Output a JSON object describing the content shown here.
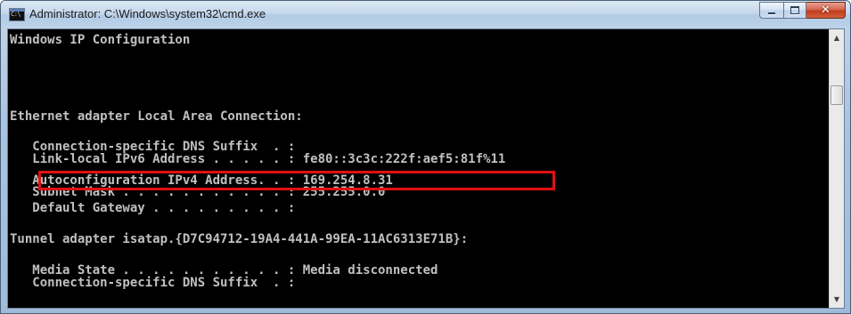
{
  "window": {
    "title": "Administrator: C:\\Windows\\system32\\cmd.exe",
    "icon": "cmd-icon",
    "icon_glyph": "C:\\",
    "minimize_icon": "minimize-icon",
    "maximize_icon": "maximize-icon",
    "close_icon": "close-icon",
    "close_glyph": "✕"
  },
  "console": {
    "lines": [
      "Windows IP Configuration",
      "",
      "",
      "Ethernet adapter Local Area Connection:",
      "",
      "   Connection-specific DNS Suffix  . :",
      "   Link-local IPv6 Address . . . . . : fe80::3c3c:222f:aef5:81f%11",
      "   Autoconfiguration IPv4 Address. . : 169.254.8.31",
      "   Subnet Mask . . . . . . . . . . . : 255.255.0.0",
      "   Default Gateway . . . . . . . . . :",
      "",
      "Tunnel adapter isatap.{D7C94712-19A4-441A-99EA-11AC6313E71B}:",
      "",
      "   Media State . . . . . . . . . . . : Media disconnected",
      "   Connection-specific DNS Suffix  . :"
    ],
    "highlight_color": "#e01010",
    "text_color": "#c0c0c0",
    "background_color": "#000000"
  },
  "scrollbar": {
    "up_arrow": "▲",
    "down_arrow": "▼"
  }
}
